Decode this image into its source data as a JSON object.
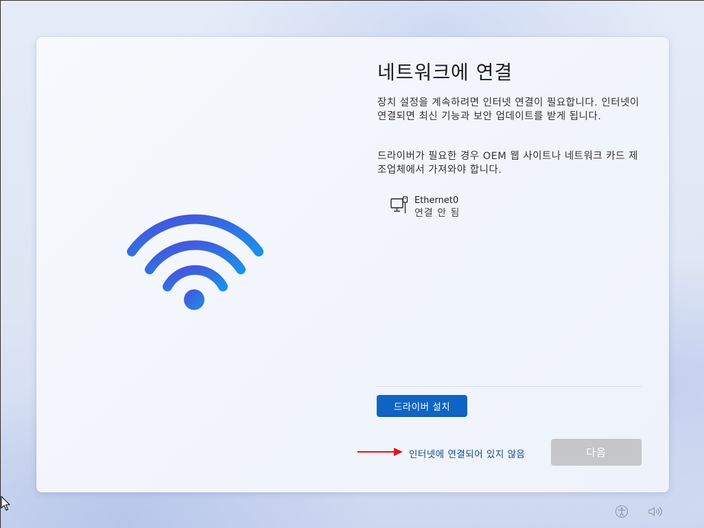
{
  "page": {
    "title": "네트워크에 연결",
    "description_1": "장치 설정을 계속하려면 인터넷 연결이 필요합니다. 인터넷이 연결되면 최신 기능과 보안 업데이트를 받게 됩니다.",
    "description_2": "드라이버가 필요한 경우 OEM 웹 사이트나 네트워크 카드 제조업체에서 가져와야 합니다."
  },
  "network": {
    "adapters": [
      {
        "name": "Ethernet0",
        "status": "연결 안 됨",
        "icon": "ethernet-icon"
      }
    ]
  },
  "actions": {
    "install_driver_label": "드라이버 설치",
    "no_internet_label": "인터넷에 연결되어 있지 않음",
    "next_label": "다음"
  },
  "tray": {
    "icons": [
      "accessibility-icon",
      "volume-icon"
    ]
  },
  "colors": {
    "accent": "#0f64c4",
    "link": "#0f4c99",
    "disabled_button": "#c4c6ca",
    "annotation_arrow": "#e0141a",
    "wifi_gradient_start": "#3f5ce0",
    "wifi_gradient_end": "#1a8de6"
  }
}
